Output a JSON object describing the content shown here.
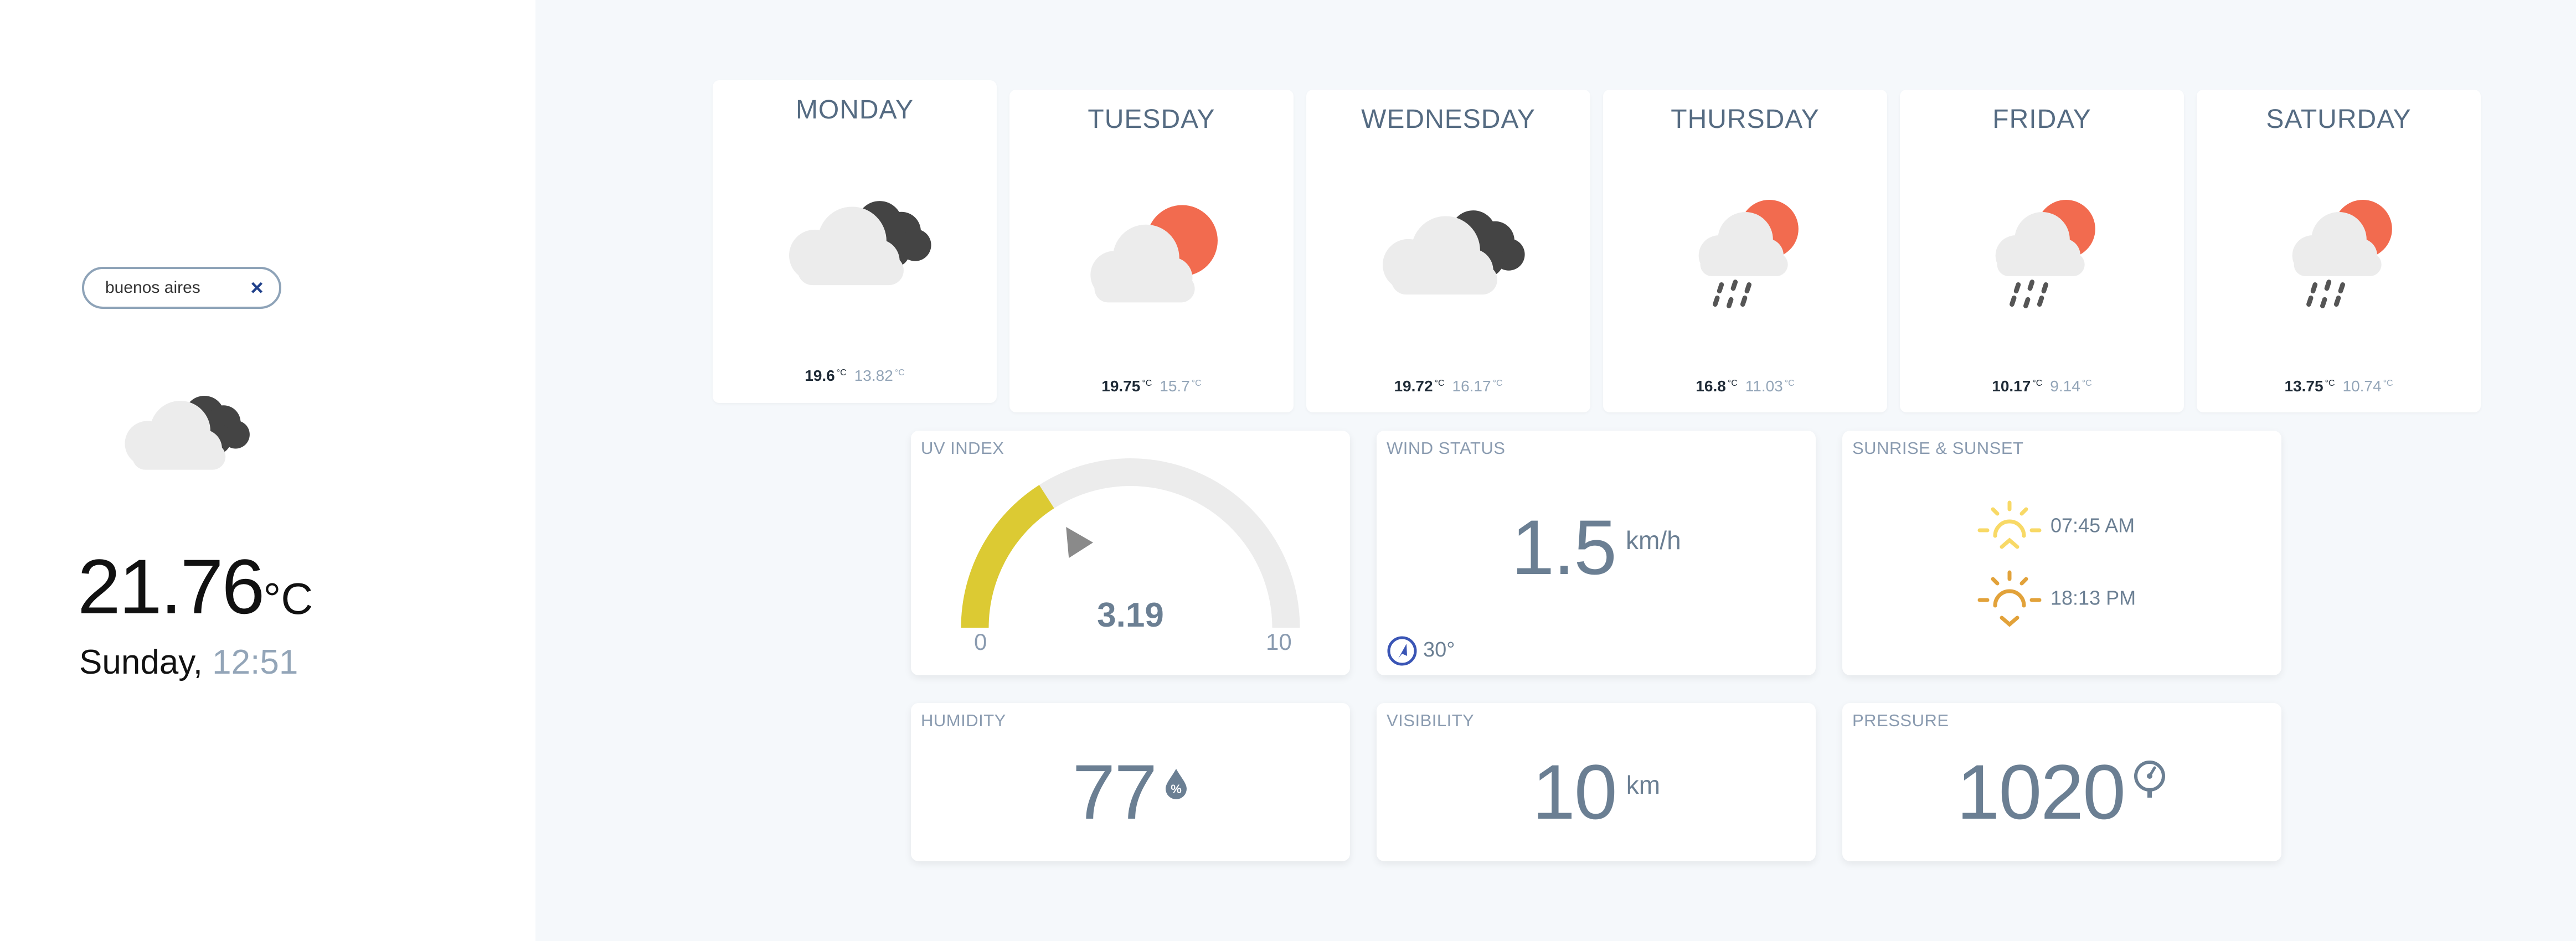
{
  "search": {
    "value": "buenos aires",
    "placeholder": "",
    "clear_label": "×"
  },
  "current": {
    "icon": "cloudy-icon",
    "temperature": "21.76",
    "unit": "°C",
    "day": "Sunday",
    "separator": ",",
    "time": "12:51"
  },
  "forecast": [
    {
      "day": "MONDAY",
      "icon": "cloudy-icon",
      "max": "19.6",
      "min": "13.82",
      "unit": "°C"
    },
    {
      "day": "TUESDAY",
      "icon": "partly-sunny-icon",
      "max": "19.75",
      "min": "15.7",
      "unit": "°C"
    },
    {
      "day": "WEDNESDAY",
      "icon": "cloudy-icon",
      "max": "19.72",
      "min": "16.17",
      "unit": "°C"
    },
    {
      "day": "THURSDAY",
      "icon": "rain-sun-icon",
      "max": "16.8",
      "min": "11.03",
      "unit": "°C"
    },
    {
      "day": "FRIDAY",
      "icon": "rain-sun-icon",
      "max": "10.17",
      "min": "9.14",
      "unit": "°C"
    },
    {
      "day": "SATURDAY",
      "icon": "rain-sun-icon",
      "max": "13.75",
      "min": "10.74",
      "unit": "°C"
    }
  ],
  "highlights": {
    "uv": {
      "title": "UV INDEX",
      "value": "3.19",
      "min_label": "0",
      "max_label": "10",
      "fraction": 0.319
    },
    "wind": {
      "title": "WIND STATUS",
      "value": "1.5",
      "unit": "km/h",
      "direction": "30°"
    },
    "sun": {
      "title": "SUNRISE & SUNSET",
      "sunrise": "07:45 AM",
      "sunset": "18:13 PM"
    },
    "humidity": {
      "title": "HUMIDITY",
      "value": "77",
      "icon": "humidity-drop-icon"
    },
    "visibility": {
      "title": "VISIBILITY",
      "value": "10",
      "unit": "km"
    },
    "pressure": {
      "title": "PRESSURE",
      "value": "1020",
      "icon": "pressure-gauge-icon"
    }
  },
  "colors": {
    "cloud_light": "#ececec",
    "cloud_dark": "#444444",
    "sun": "#f26b4f",
    "rain": "#555555",
    "uv_fill": "#dcca33",
    "uv_track": "#ececec",
    "sunrise": "#f8d966",
    "sunset": "#e2a23a",
    "accent_blue": "#3a55b5"
  }
}
